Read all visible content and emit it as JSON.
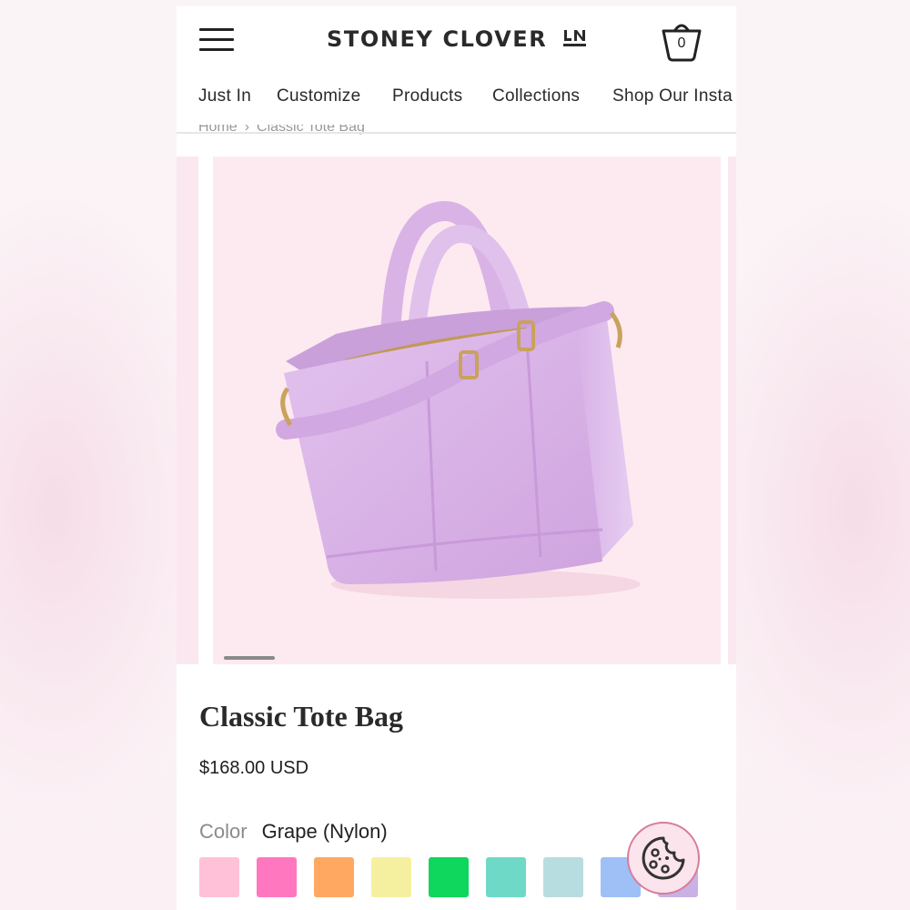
{
  "header": {
    "logo_text": "STONEY CLOVER",
    "logo_mark": "LN",
    "cart_count": "0"
  },
  "nav": {
    "items": [
      "Just In",
      "Customize",
      "Products",
      "Collections",
      "Shop Our Insta"
    ]
  },
  "breadcrumb": {
    "home": "Home",
    "current": "Classic Tote Bag"
  },
  "gallery": {
    "active_slide": 1
  },
  "product": {
    "title": "Classic Tote Bag",
    "price": "$168.00 USD",
    "color_label": "Color",
    "color_value": "Grape (Nylon)",
    "swatches": [
      "#ffc1d8",
      "#ff78bf",
      "#ffa862",
      "#f4f0a0",
      "#0fd65c",
      "#6fd9c8",
      "#b8dde0",
      "#9fbff7",
      "#c9b1e6"
    ]
  },
  "icons": {
    "menu": "hamburger-menu-icon",
    "cart": "shopping-basket-icon",
    "cookie": "cookie-icon"
  },
  "colors": {
    "slide_bg": "#fdeaf1",
    "bag": "#d9b2e6",
    "accent_pink": "#d77c9a"
  }
}
